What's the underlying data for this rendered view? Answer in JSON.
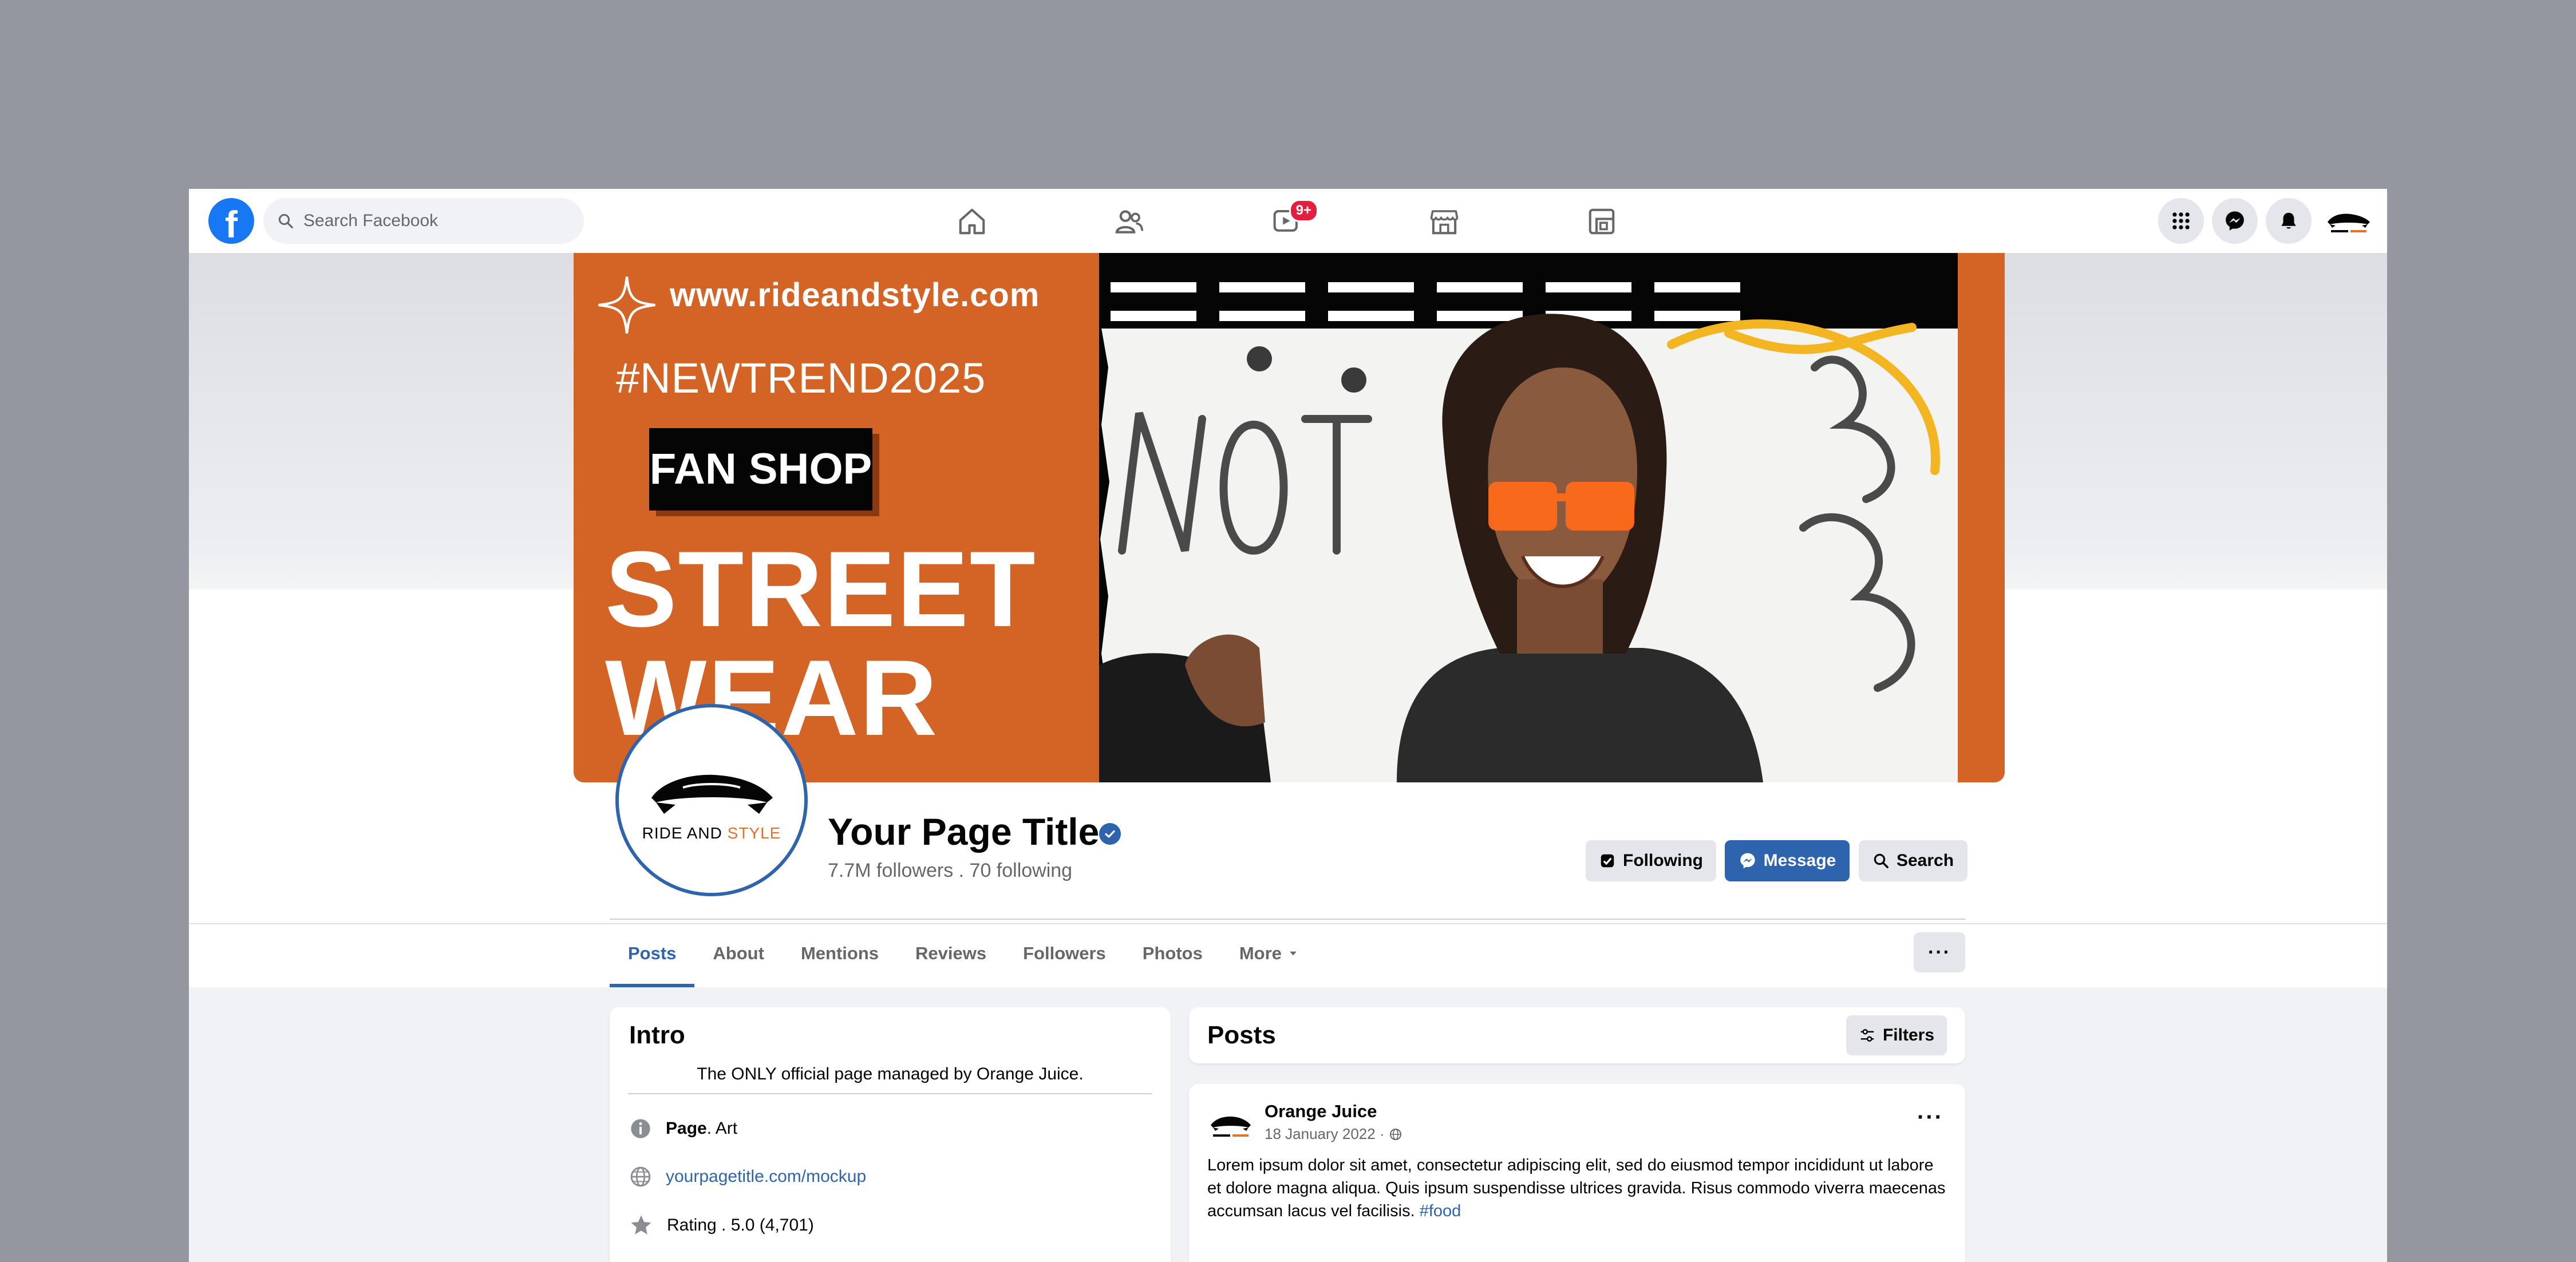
{
  "topbar": {
    "search_placeholder": "Search Facebook",
    "video_badge": "9+",
    "nav_icons": [
      "home-icon",
      "friends-icon",
      "video-icon",
      "marketplace-icon",
      "gaming-icon"
    ],
    "right_icons": [
      "menu-grid-icon",
      "messenger-icon",
      "notifications-icon"
    ]
  },
  "cover": {
    "url": "www.rideandstyle.com",
    "hashtag": "#NEWTREND2025",
    "badge": "FAN SHOP",
    "headline_1": "STREET",
    "headline_2": "WEAR",
    "accent_color": "#d46426"
  },
  "profile": {
    "logo_text_1": "RIDE AND",
    "logo_text_2": "STYLE",
    "title": "Your Page Title",
    "stats": "7.7M followers . 70 following",
    "buttons": {
      "following": "Following",
      "message": "Message",
      "search": "Search"
    }
  },
  "tabs": {
    "items": [
      "Posts",
      "About",
      "Mentions",
      "Reviews",
      "Followers",
      "Photos",
      "More"
    ],
    "active": "Posts",
    "overflow": "···"
  },
  "intro": {
    "heading": "Intro",
    "description": "The ONLY official page managed by Orange Juice.",
    "page_label": "Page",
    "page_category": " . Art",
    "website": "yourpagetitle.com/mockup",
    "rating": "Rating . 5.0 (4,701)"
  },
  "posts": {
    "heading": "Posts",
    "filters_label": "Filters",
    "post": {
      "author": "Orange Juice",
      "date": "18 January 2022",
      "date_separator": " · ",
      "body": "Lorem ipsum dolor sit amet, consectetur adipiscing elit, sed do eiusmod tempor incididunt ut labore et dolore magna aliqua. Quis ipsum suspendisse ultrices gravida. Risus commodo viverra maecenas accumsan lacus vel facilisis. ",
      "hashtag": "#food",
      "menu": "···"
    }
  },
  "colors": {
    "brand_blue": "#1877f2",
    "accent_blue": "#2e63ad",
    "badge_red": "#e41e3f"
  }
}
